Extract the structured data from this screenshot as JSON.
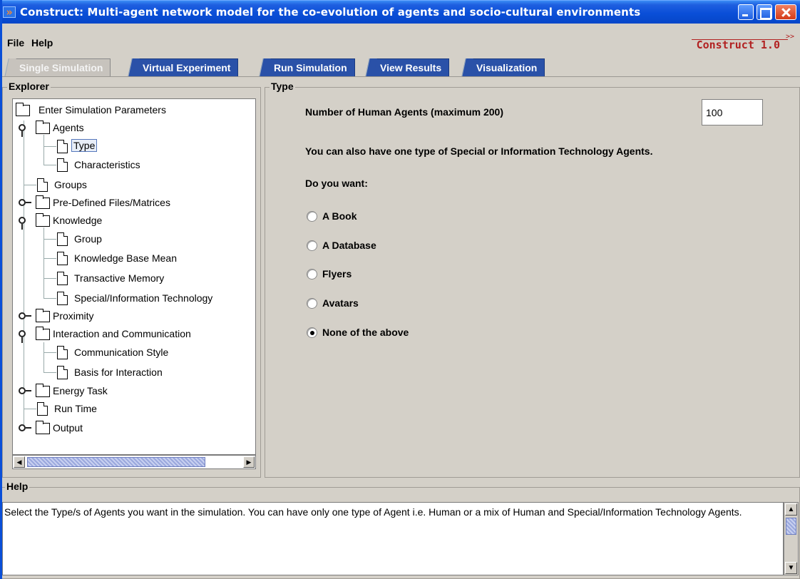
{
  "window": {
    "title": "Construct: Multi-agent network model for the co-evolution of agents and socio-cultural environments",
    "app_icon": "double-chevron-icon",
    "controls": [
      "minimize",
      "maximize",
      "close"
    ]
  },
  "menu": {
    "file_label": "File",
    "help_label": "Help",
    "brand": "Construct 1.0",
    "brand_arrow": ">>"
  },
  "tabs": [
    {
      "label": "Single Simulation",
      "active": true
    },
    {
      "label": "Virtual Experiment",
      "active": false
    },
    {
      "label": "Run Simulation",
      "active": false
    },
    {
      "label": "View Results",
      "active": false
    },
    {
      "label": "Visualization",
      "active": false
    }
  ],
  "explorer": {
    "title": "Explorer",
    "nodes": [
      {
        "label": "Enter Simulation Parameters",
        "kind": "folder"
      },
      {
        "label": "Agents",
        "kind": "folder",
        "expanded": true
      },
      {
        "label": "Type",
        "kind": "doc",
        "selected": true
      },
      {
        "label": "Characteristics",
        "kind": "doc"
      },
      {
        "label": "Groups",
        "kind": "doc"
      },
      {
        "label": "Pre-Defined Files/Matrices",
        "kind": "folder",
        "expanded": false
      },
      {
        "label": "Knowledge",
        "kind": "folder",
        "expanded": true
      },
      {
        "label": "Group",
        "kind": "doc"
      },
      {
        "label": "Knowledge Base Mean",
        "kind": "doc"
      },
      {
        "label": "Transactive Memory",
        "kind": "doc"
      },
      {
        "label": "Special/Information Technology",
        "kind": "doc"
      },
      {
        "label": "Proximity",
        "kind": "folder",
        "expanded": false
      },
      {
        "label": "Interaction and Communication",
        "kind": "folder",
        "expanded": true
      },
      {
        "label": "Communication Style",
        "kind": "doc"
      },
      {
        "label": "Basis for Interaction",
        "kind": "doc"
      },
      {
        "label": "Energy Task",
        "kind": "folder",
        "expanded": false
      },
      {
        "label": "Run Time",
        "kind": "doc"
      },
      {
        "label": "Output",
        "kind": "folder",
        "expanded": false
      }
    ]
  },
  "type_panel": {
    "title": "Type",
    "human_agents_label": "Number of Human Agents (maximum 200)",
    "human_agents_value": "100",
    "special_note": "You can also have one type of Special or Information Technology Agents.",
    "question": "Do you want:",
    "options": [
      {
        "label": "A Book",
        "checked": false
      },
      {
        "label": "A Database",
        "checked": false
      },
      {
        "label": "Flyers",
        "checked": false
      },
      {
        "label": "Avatars",
        "checked": false
      },
      {
        "label": "None of the above",
        "checked": true
      }
    ]
  },
  "help": {
    "title": "Help",
    "text": "Select the Type/s of Agents you want  in the simulation. You can have only one type of Agent i.e. Human or a mix of Human and Special/Information Technology Agents."
  }
}
